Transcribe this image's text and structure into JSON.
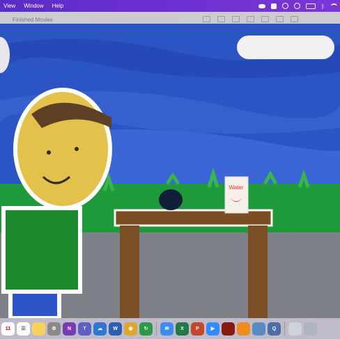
{
  "menubar": {
    "items": [
      {
        "label": "View"
      },
      {
        "label": "Window"
      },
      {
        "label": "Help"
      }
    ]
  },
  "window": {
    "title": "Finished Movies"
  },
  "scene": {
    "sign_text": "Water"
  },
  "dock": {
    "calendar_day": "11",
    "colors": {
      "bar": "#d2cddc",
      "menubar": "#6a2fd0"
    }
  }
}
